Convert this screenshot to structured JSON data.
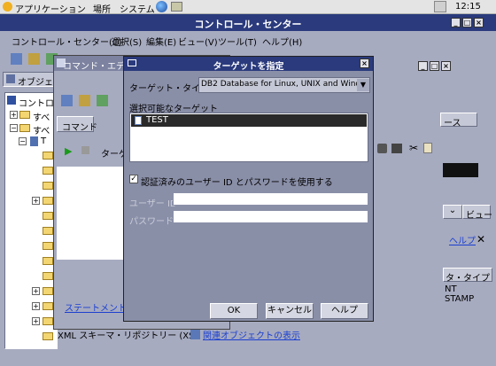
{
  "topbar": {
    "apps": "アプリケーション",
    "places": "場所",
    "system": "システム",
    "clock": "12:15"
  },
  "main_window": {
    "title": "コントロール・センター",
    "menu": [
      "コントロール・センター(C)",
      "選択(S)",
      "編集(E)",
      "ビュー(V)",
      "ツール(T)",
      "ヘルプ(H)"
    ]
  },
  "left_panel": {
    "tab": "オブジェ",
    "tree": [
      "コントロ",
      "すべ",
      "すべ",
      "T",
      "XML スキーマ・リポジトリー (XSR"
    ]
  },
  "cmd_editor": {
    "title": "コマンド・エディ",
    "tab": "コマンド",
    "target_label": "ターゲ",
    "statement_link": "ステートメント終"
  },
  "right_panel": {
    "source_label": "ース",
    "view_button": "ビュー",
    "help_link": "ヘルプ",
    "column_header": "タ・タイプ",
    "rows": [
      "NT",
      "STAMP"
    ],
    "related_link": "関連オブジェクトの表示"
  },
  "dialog": {
    "title": "ターゲットを指定",
    "type_label": "ターゲット・タイプ",
    "type_value": "DB2 Database for Linux, UNIX and Wind...",
    "available_label": "選択可能なターゲット",
    "targets": [
      "TEST"
    ],
    "checkbox_label": "認証済みのユーザー ID とパスワードを使用する",
    "checkbox_checked": true,
    "user_label": "ユーザー ID",
    "password_label": "パスワード",
    "ok": "OK",
    "cancel": "キャンセル",
    "help": "ヘルプ"
  },
  "colors": {
    "accent": "#2a3a7c",
    "selection": "#2a2a2a",
    "window_bg": "#8a8fa8",
    "link": "#1a3fd0"
  }
}
